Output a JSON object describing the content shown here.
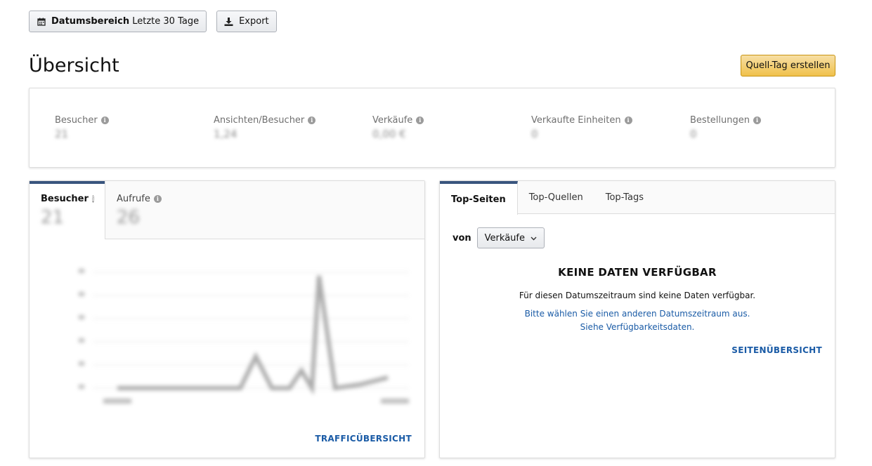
{
  "toolbar": {
    "date_range_bold": "Datumsbereich",
    "date_range_value": "Letzte 30 Tage",
    "export_label": "Export",
    "calendar_icon": "calendar-icon",
    "download_icon": "download-icon"
  },
  "page": {
    "title": "Übersicht",
    "create_tag_label": "Quell-Tag erstellen"
  },
  "metrics": [
    {
      "label": "Besucher",
      "value": "21"
    },
    {
      "label": "Ansichten/Besucher",
      "value": "1,24"
    },
    {
      "label": "Verkäufe",
      "value": "0,00 €"
    },
    {
      "label": "Verkaufte Einheiten",
      "value": "0"
    },
    {
      "label": "Bestellungen",
      "value": "0"
    }
  ],
  "traffic": {
    "tabs": [
      {
        "label": "Besucher",
        "value": "21"
      },
      {
        "label": "Aufrufe",
        "value": "26"
      }
    ],
    "link": "TRAFFICÜBERSICHT"
  },
  "top": {
    "tabs": [
      "Top-Seiten",
      "Top-Quellen",
      "Top-Tags"
    ],
    "von_label": "von",
    "select_value": "Verkäufe",
    "nodata_title": "KEINE DATEN VERFÜGBAR",
    "nodata_text": "Für diesen Datumszeitraum sind keine Daten verfügbar.",
    "nodata_link1": "Bitte wählen Sie einen anderen Datumszeitraum aus.",
    "nodata_link2": "Siehe Verfügbarkeitsdaten.",
    "link": "SEITENÜBERSICHT"
  },
  "colors": {
    "accent_tab": "#39557e",
    "link": "#1a5ba6",
    "primary_button": "#f0c14b"
  }
}
